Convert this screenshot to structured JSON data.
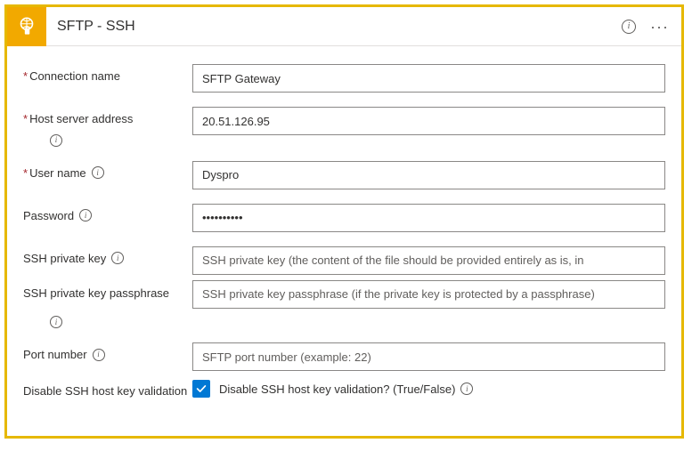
{
  "header": {
    "title": "SFTP - SSH"
  },
  "fields": {
    "connectionName": {
      "label": "Connection name",
      "required": true,
      "value": "SFTP Gateway"
    },
    "hostServerAddress": {
      "label": "Host server address",
      "required": true,
      "value": "20.51.126.95"
    },
    "userName": {
      "label": "User name",
      "required": true,
      "value": "Dyspro"
    },
    "password": {
      "label": "Password",
      "required": false,
      "value": "••••••••••"
    },
    "sshPrivateKey": {
      "label": "SSH private key",
      "required": false,
      "placeholder": "SSH private key (the content of the file should be provided entirely as is, in"
    },
    "sshPrivateKeyPassphrase": {
      "label": "SSH private key passphrase",
      "required": false,
      "placeholder": "SSH private key passphrase (if the private key is protected by a passphrase)"
    },
    "portNumber": {
      "label": "Port number",
      "required": false,
      "placeholder": "SFTP port number (example: 22)"
    },
    "disableSshHostKeyValidation": {
      "label": "Disable SSH host key validation",
      "checkboxLabel": "Disable SSH host key validation? (True/False)",
      "checked": true
    }
  }
}
